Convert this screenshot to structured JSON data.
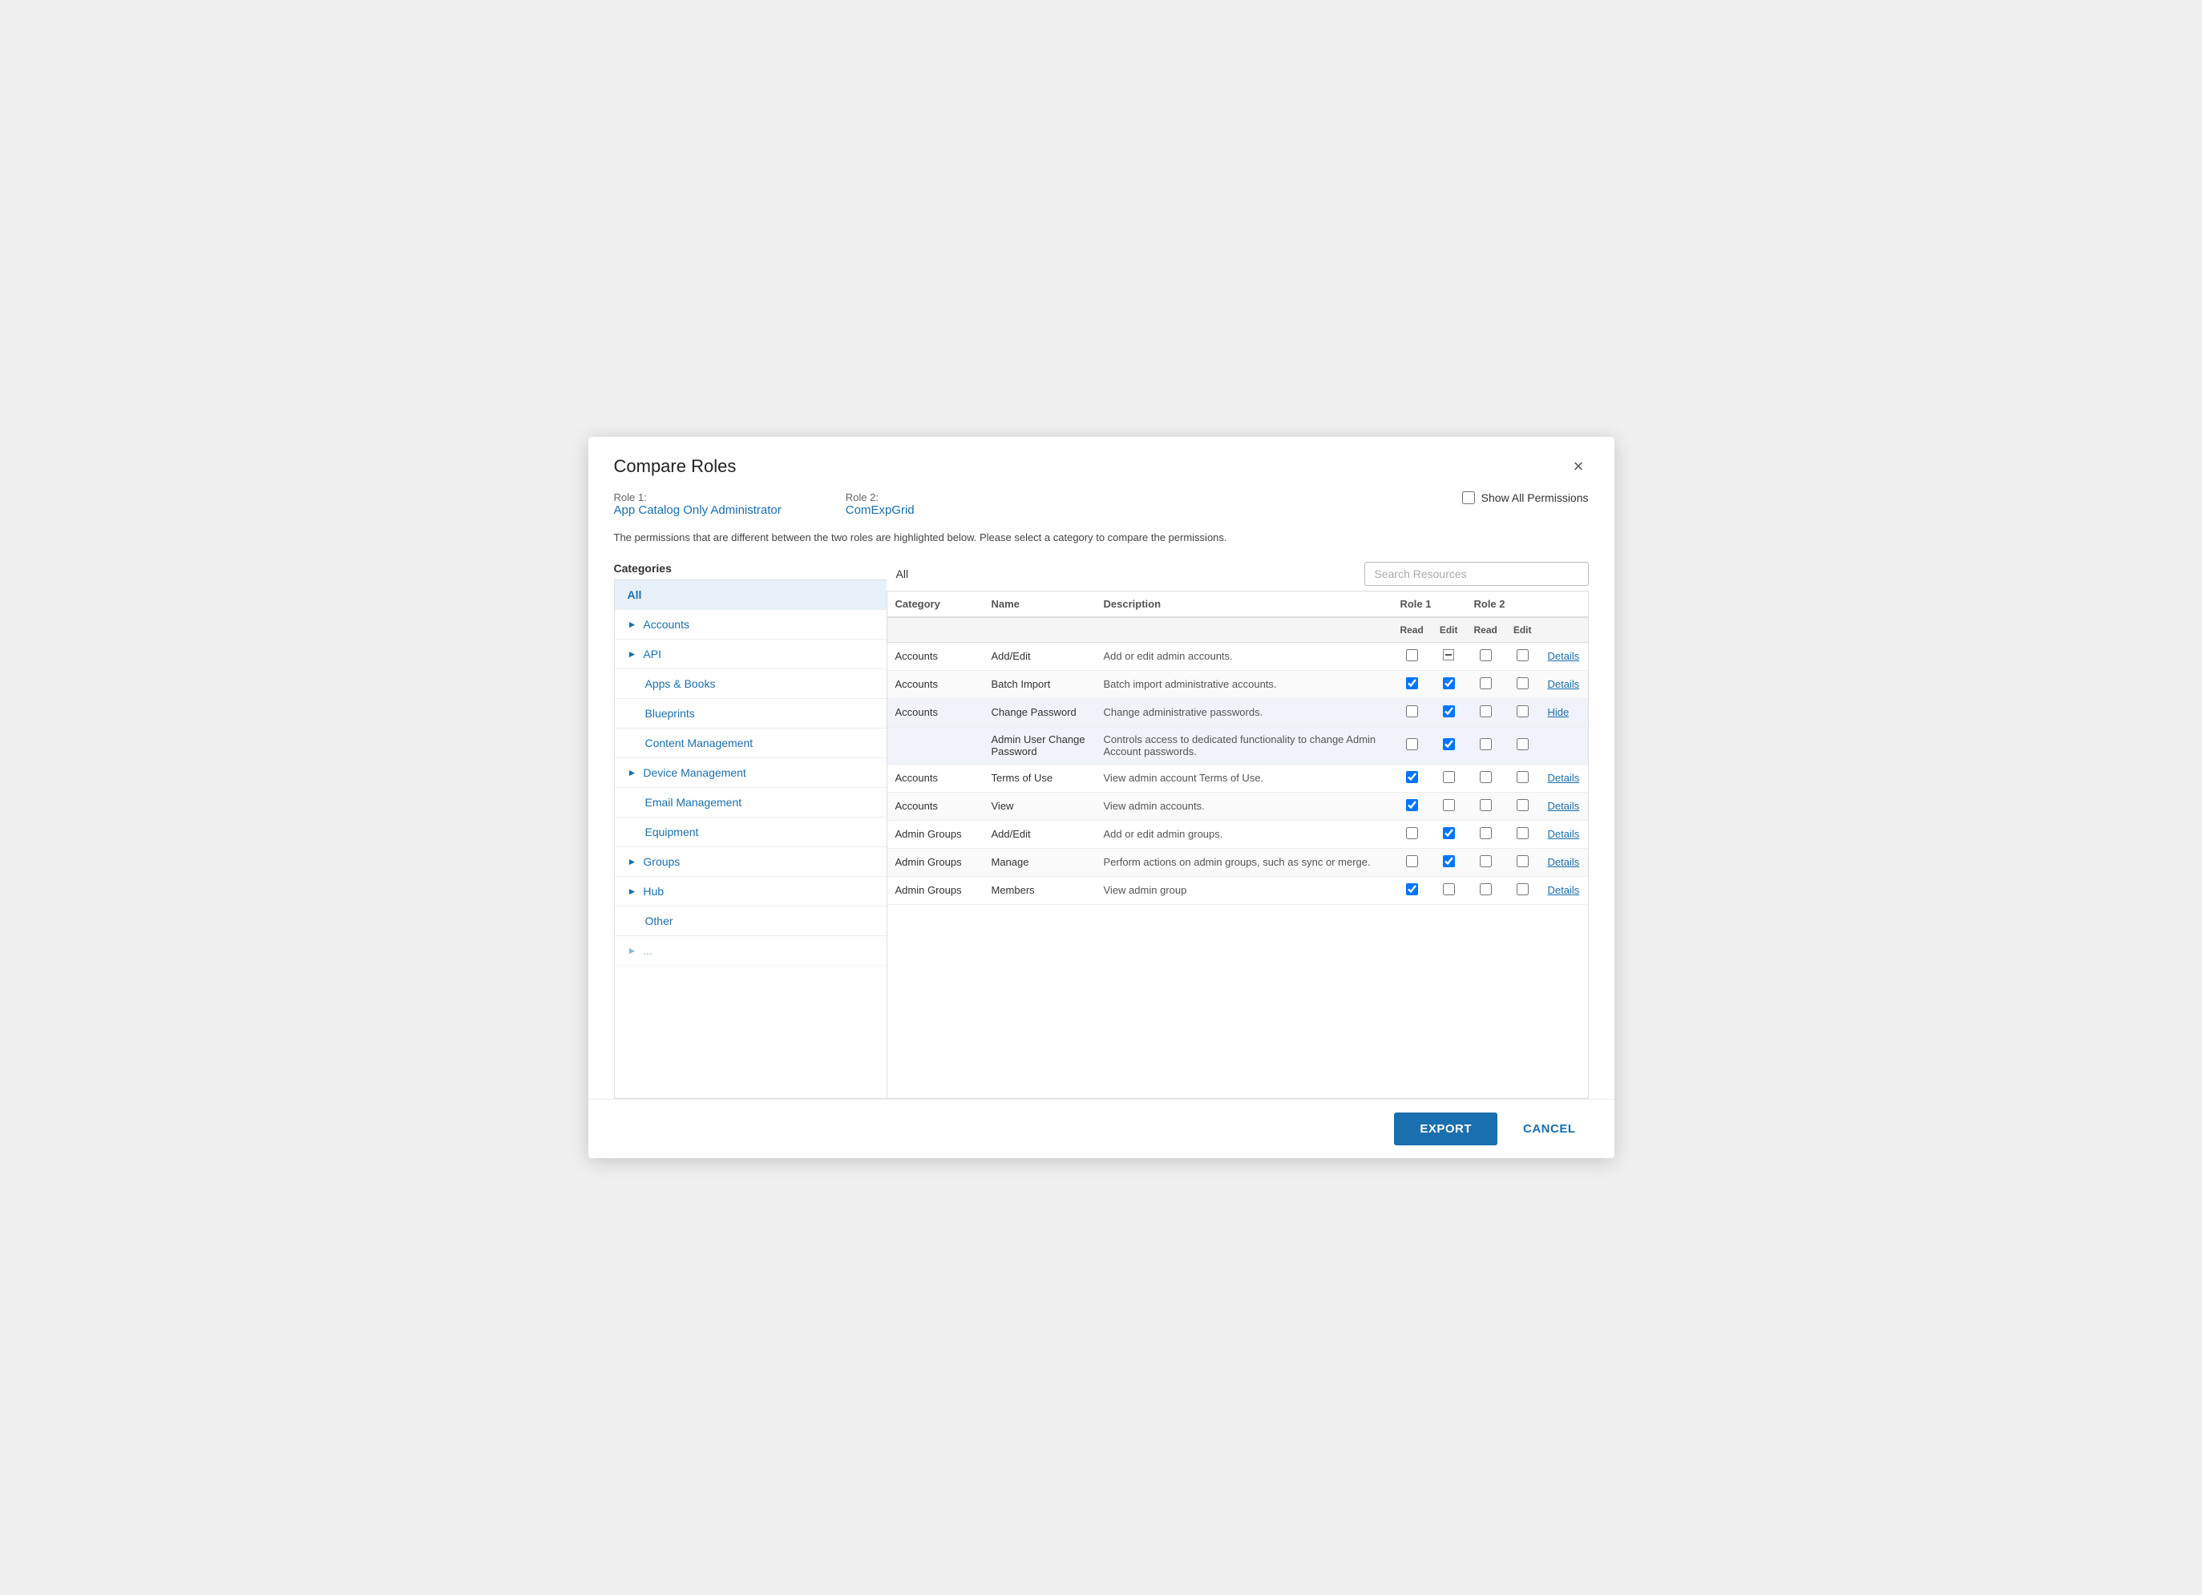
{
  "dialog": {
    "title": "Compare Roles",
    "close_label": "×"
  },
  "role1": {
    "label": "Role 1:",
    "value": "App Catalog Only Administrator"
  },
  "role2": {
    "label": "Role 2:",
    "value": "ComExpGrid"
  },
  "show_all": {
    "label": "Show All Permissions"
  },
  "description": "The permissions that are different between the two roles are highlighted below. Please select a category to compare the permissions.",
  "categories": {
    "header": "Categories",
    "items": [
      {
        "label": "All",
        "active": true,
        "indent": false,
        "has_chevron": false
      },
      {
        "label": "Accounts",
        "active": false,
        "indent": false,
        "has_chevron": true
      },
      {
        "label": "API",
        "active": false,
        "indent": false,
        "has_chevron": true
      },
      {
        "label": "Apps & Books",
        "active": false,
        "indent": false,
        "has_chevron": false
      },
      {
        "label": "Blueprints",
        "active": false,
        "indent": false,
        "has_chevron": false
      },
      {
        "label": "Content Management",
        "active": false,
        "indent": false,
        "has_chevron": false
      },
      {
        "label": "Device Management",
        "active": false,
        "indent": false,
        "has_chevron": true
      },
      {
        "label": "Email Management",
        "active": false,
        "indent": false,
        "has_chevron": false
      },
      {
        "label": "Equipment",
        "active": false,
        "indent": false,
        "has_chevron": false
      },
      {
        "label": "Groups",
        "active": false,
        "indent": false,
        "has_chevron": true
      },
      {
        "label": "Hub",
        "active": false,
        "indent": false,
        "has_chevron": true
      },
      {
        "label": "Other",
        "active": false,
        "indent": false,
        "has_chevron": false
      }
    ]
  },
  "table": {
    "all_label": "All",
    "search_placeholder": "Search Resources",
    "columns": {
      "category": "Category",
      "name": "Name",
      "description": "Description",
      "role1": "Role 1",
      "role2": "Role 2",
      "read": "Read",
      "edit": "Edit"
    },
    "rows": [
      {
        "category": "Accounts",
        "name": "Add/Edit",
        "description": "Add or edit admin accounts.",
        "r1_read": false,
        "r1_edit": "minus",
        "r2_read": false,
        "r2_edit": false,
        "action": "Details",
        "highlighted": false
      },
      {
        "category": "Accounts",
        "name": "Batch Import",
        "description": "Batch import administrative accounts.",
        "r1_read": true,
        "r1_edit": true,
        "r2_read": false,
        "r2_edit": false,
        "action": "Details",
        "highlighted": false
      },
      {
        "category": "Accounts",
        "name": "Change Password",
        "description": "Change administrative passwords.",
        "r1_read": false,
        "r1_edit": true,
        "r2_read": false,
        "r2_edit": false,
        "action": "Hide",
        "highlighted": true
      },
      {
        "category": "",
        "name": "Admin User Change Password",
        "description": "Controls access to dedicated functionality to change Admin Account passwords. <br />",
        "r1_read": false,
        "r1_edit": true,
        "r2_read": false,
        "r2_edit": false,
        "action": "",
        "highlighted": true,
        "sub": true
      },
      {
        "category": "Accounts",
        "name": "Terms of Use",
        "description": "View admin account Terms of Use.",
        "r1_read": true,
        "r1_edit": false,
        "r2_read": false,
        "r2_edit": false,
        "action": "Details",
        "highlighted": false
      },
      {
        "category": "Accounts",
        "name": "View",
        "description": "View admin accounts.",
        "r1_read": true,
        "r1_edit": false,
        "r2_read": false,
        "r2_edit": false,
        "action": "Details",
        "highlighted": false
      },
      {
        "category": "Admin Groups",
        "name": "Add/Edit",
        "description": "Add or edit admin groups.",
        "r1_read": false,
        "r1_edit": true,
        "r2_read": false,
        "r2_edit": false,
        "action": "Details",
        "highlighted": false
      },
      {
        "category": "Admin Groups",
        "name": "Manage",
        "description": "Perform actions on admin groups, such as sync or merge.",
        "r1_read": false,
        "r1_edit": true,
        "r2_read": false,
        "r2_edit": false,
        "action": "Details",
        "highlighted": false
      },
      {
        "category": "Admin Groups",
        "name": "Members",
        "description": "View admin group",
        "r1_read": true,
        "r1_edit": false,
        "r2_read": false,
        "r2_edit": false,
        "action": "Details",
        "highlighted": false,
        "partial": true
      }
    ]
  },
  "footer": {
    "export_label": "EXPORT",
    "cancel_label": "CANCEL"
  }
}
